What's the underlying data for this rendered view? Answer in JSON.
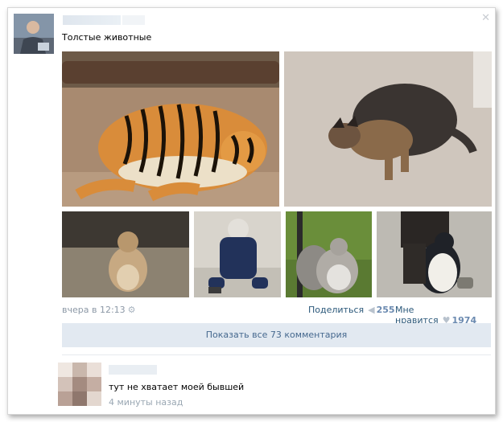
{
  "post": {
    "text": "Толстые животные",
    "time": "вчера в 12:13",
    "share_label": "Поделиться",
    "share_count": "255",
    "like_label": "Мне нравится",
    "like_count": "1974",
    "show_comments": "Показать все 73 комментария",
    "close_icon": "close-icon",
    "photos": [
      {
        "subject": "tiger"
      },
      {
        "subject": "dog"
      },
      {
        "subject": "prairie-dog"
      },
      {
        "subject": "cat"
      },
      {
        "subject": "squirrel"
      },
      {
        "subject": "penguin"
      }
    ]
  },
  "comment": {
    "text": "тут не хватает моей бывшей",
    "time": "4 минуты назад"
  },
  "colors": {
    "link": "#2b587a",
    "meta": "#8c98a6",
    "button_bg": "#e2e9f1",
    "button_text": "#45688e"
  }
}
